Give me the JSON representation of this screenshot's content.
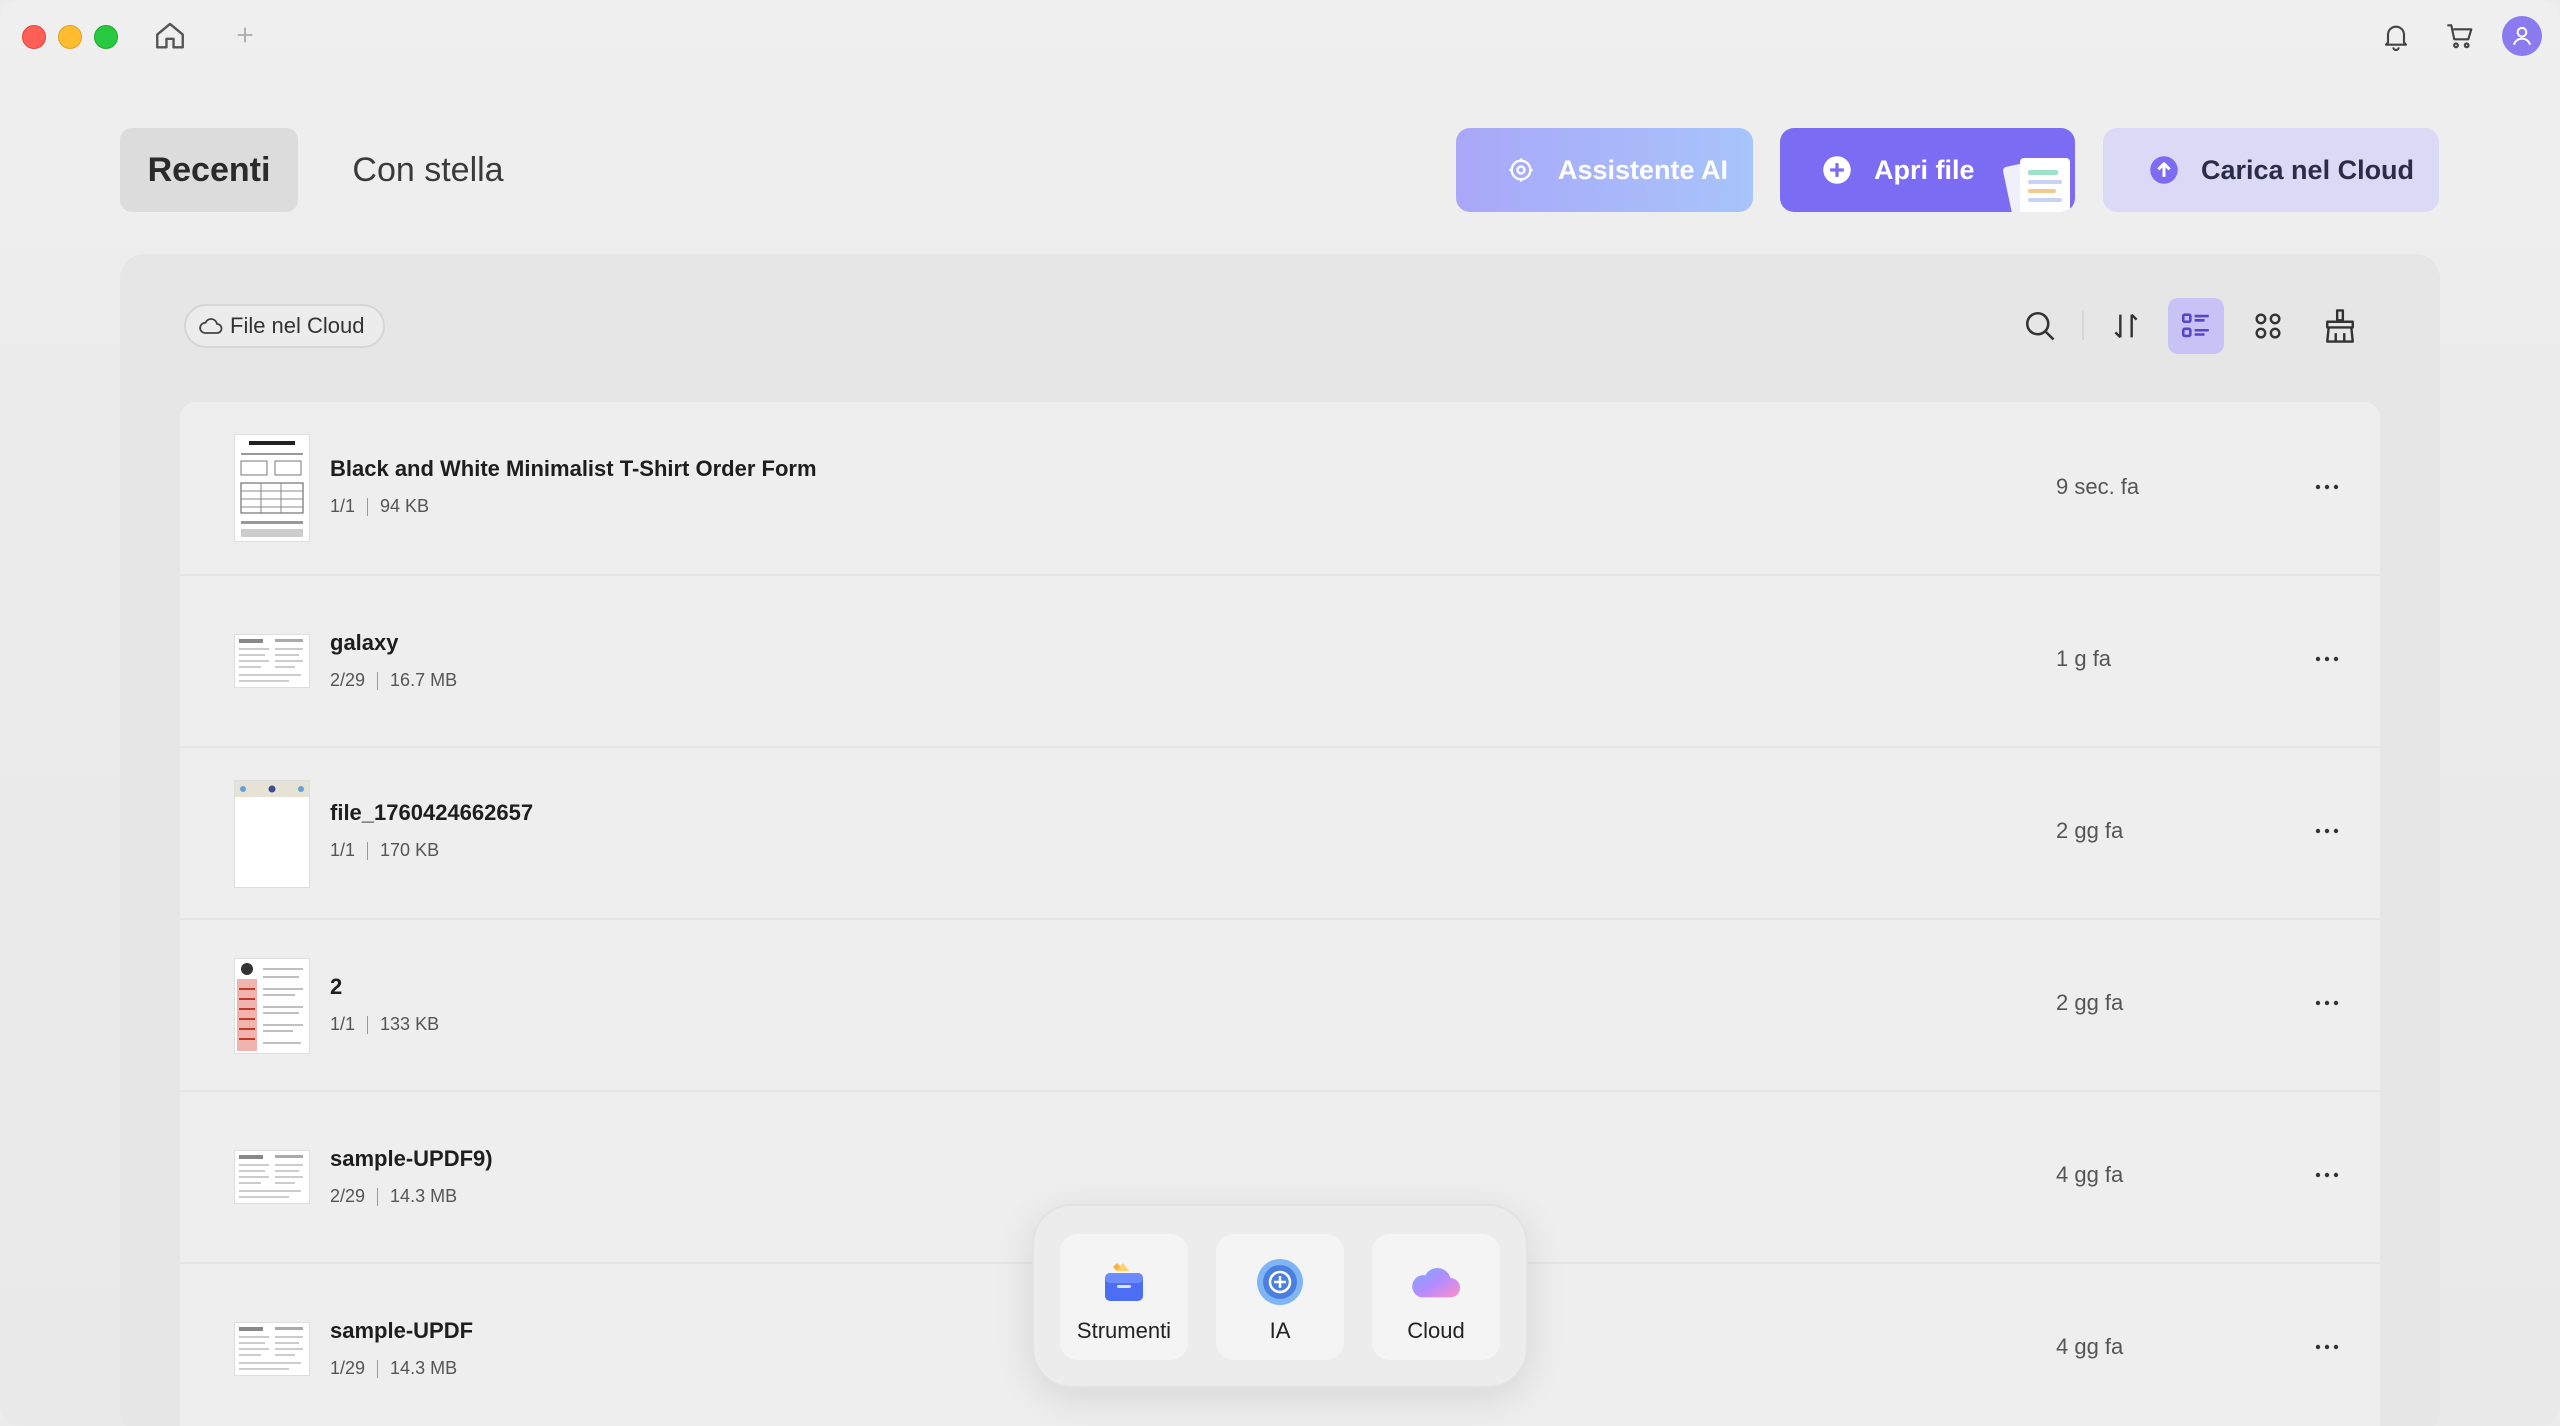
{
  "header": {
    "tabs": [
      {
        "label": "Recenti",
        "active": true
      },
      {
        "label": "Con stella",
        "active": false
      }
    ],
    "actions": {
      "ai_label": "Assistente AI",
      "open_label": "Apri file",
      "cloud_label": "Carica nel Cloud"
    }
  },
  "toolbar": {
    "cloud_chip_label": "File nel Cloud",
    "icons": [
      "search-icon",
      "sort-icon",
      "list-view-icon",
      "grid-view-icon",
      "clean-icon"
    ],
    "active_view": "list"
  },
  "files": [
    {
      "name": "Black and White Minimalist T-Shirt Order Form",
      "pages": "1/1",
      "size": "94 KB",
      "time": "9 sec. fa"
    },
    {
      "name": "galaxy",
      "pages": "2/29",
      "size": "16.7 MB",
      "time": "1 g fa"
    },
    {
      "name": "file_1760424662657",
      "pages": "1/1",
      "size": "170 KB",
      "time": "2 gg fa"
    },
    {
      "name": "2",
      "pages": "1/1",
      "size": "133 KB",
      "time": "2 gg fa"
    },
    {
      "name": "sample-UPDF9)",
      "pages": "2/29",
      "size": "14.3 MB",
      "time": "4 gg fa"
    },
    {
      "name": "sample-UPDF",
      "pages": "1/29",
      "size": "14.3 MB",
      "time": "4 gg fa"
    }
  ],
  "dock": {
    "items": [
      {
        "label": "Strumenti",
        "icon": "toolbox-icon"
      },
      {
        "label": "IA",
        "icon": "ai-icon"
      },
      {
        "label": "Cloud",
        "icon": "cloud-icon"
      }
    ]
  },
  "colors": {
    "accent": "#7b6cf3",
    "active_view_bg": "#c9c2f6",
    "avatar": "#8a7bf0"
  }
}
